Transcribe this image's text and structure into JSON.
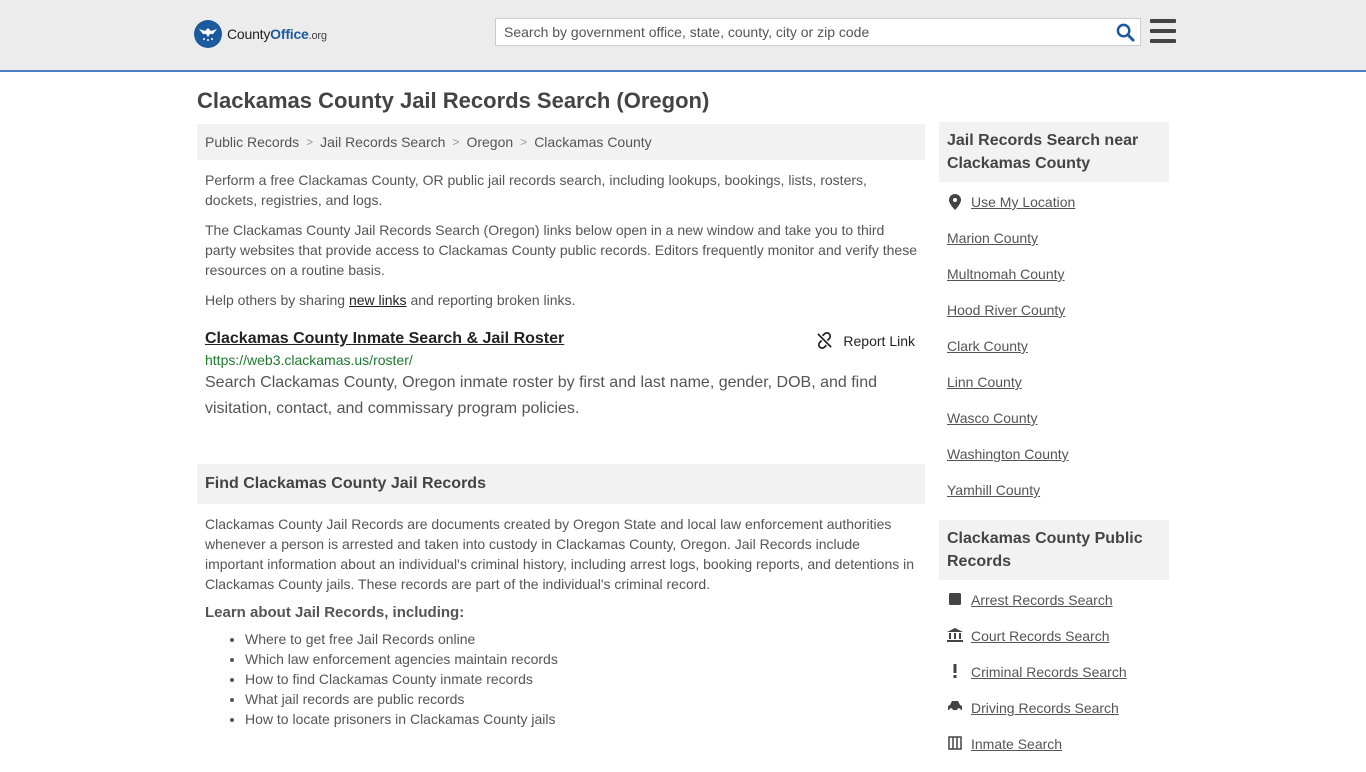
{
  "header": {
    "logo_primary": "County",
    "logo_secondary": "Office",
    "logo_tld": ".org",
    "search_placeholder": "Search by government office, state, county, city or zip code"
  },
  "page_title": "Clackamas County Jail Records Search (Oregon)",
  "breadcrumb": [
    "Public Records",
    "Jail Records Search",
    "Oregon",
    "Clackamas County"
  ],
  "intro": {
    "p1": "Perform a free Clackamas County, OR public jail records search, including lookups, bookings, lists, rosters, dockets, registries, and logs.",
    "p2": "The Clackamas County Jail Records Search (Oregon) links below open in a new window and take you to third party websites that provide access to Clackamas County public records. Editors frequently monitor and verify these resources on a routine basis.",
    "p3_before": "Help others by sharing ",
    "p3_link": "new links",
    "p3_after": " and reporting broken links."
  },
  "result": {
    "title": "Clackamas County Inmate Search & Jail Roster",
    "report_label": "Report Link",
    "url": "https://web3.clackamas.us/roster/",
    "description": "Search Clackamas County, Oregon inmate roster by first and last name, gender, DOB, and find visitation, contact, and commissary program policies."
  },
  "find_section": {
    "heading": "Find Clackamas County Jail Records",
    "body": "Clackamas County Jail Records are documents created by Oregon State and local law enforcement authorities whenever a person is arrested and taken into custody in Clackamas County, Oregon. Jail Records include important information about an individual's criminal history, including arrest logs, booking reports, and detentions in Clackamas County jails. These records are part of the individual's criminal record.",
    "learn_heading": "Learn about Jail Records, including:",
    "learn_items": [
      "Where to get free Jail Records online",
      "Which law enforcement agencies maintain records",
      "How to find Clackamas County inmate records",
      "What jail records are public records",
      "How to locate prisoners in Clackamas County jails"
    ]
  },
  "sidebar": {
    "nearby_heading": "Jail Records Search near Clackamas County",
    "use_location": "Use My Location",
    "nearby": [
      "Marion County",
      "Multnomah County",
      "Hood River County",
      "Clark County",
      "Linn County",
      "Wasco County",
      "Washington County",
      "Yamhill County"
    ],
    "public_heading": "Clackamas County Public Records",
    "public_records": [
      {
        "label": "Arrest Records Search",
        "icon": "square-icon"
      },
      {
        "label": "Court Records Search",
        "icon": "courthouse-icon"
      },
      {
        "label": "Criminal Records Search",
        "icon": "exclamation-icon"
      },
      {
        "label": "Driving Records Search",
        "icon": "car-icon"
      },
      {
        "label": "Inmate Search",
        "icon": "inmate-icon"
      }
    ]
  },
  "colors": {
    "brand": "#1b5a9c",
    "header_border": "#4a7fc1",
    "url_green": "#1d7a2f",
    "panel_bg": "#f2f2f2"
  }
}
